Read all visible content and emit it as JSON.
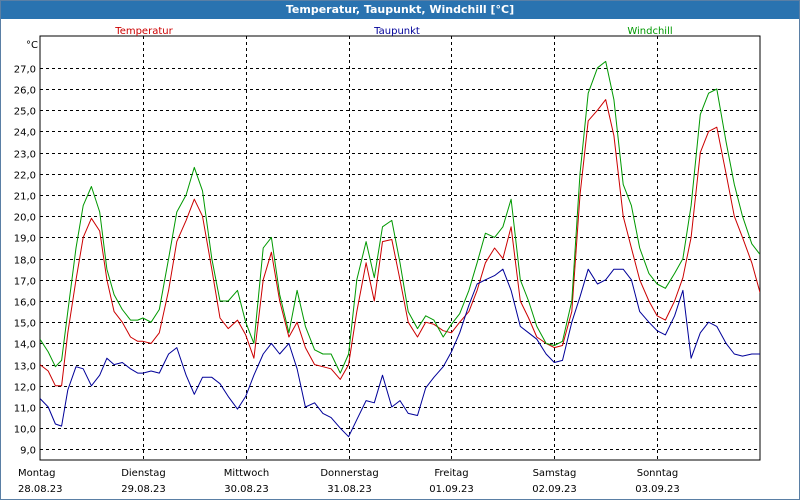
{
  "window": {
    "title": "Temperatur, Taupunkt, Windchill [°C]"
  },
  "chart_data": {
    "type": "line",
    "title": "Temperatur, Taupunkt, Windchill [°C]",
    "ylabel": "°C",
    "ylim": [
      8.5,
      28.5
    ],
    "yticks": [
      "9,0",
      "10,0",
      "11,0",
      "12,0",
      "13,0",
      "14,0",
      "15,0",
      "16,0",
      "17,0",
      "18,0",
      "19,0",
      "20,0",
      "21,0",
      "22,0",
      "23,0",
      "24,0",
      "25,0",
      "26,0",
      "27,0"
    ],
    "xlim": [
      0,
      7
    ],
    "x_unit": "days since 28.08.23 00:00",
    "days": [
      {
        "weekday": "Montag",
        "date": "28.08.23"
      },
      {
        "weekday": "Dienstag",
        "date": "29.08.23"
      },
      {
        "weekday": "Mittwoch",
        "date": "30.08.23"
      },
      {
        "weekday": "Donnerstag",
        "date": "31.08.23"
      },
      {
        "weekday": "Freitag",
        "date": "01.09.23"
      },
      {
        "weekday": "Samstag",
        "date": "02.09.23"
      },
      {
        "weekday": "Sonntag",
        "date": "03.09.23"
      }
    ],
    "grid": true,
    "legend_position": "top",
    "series": [
      {
        "name": "Temperatur",
        "color": "#cc0000",
        "x": [
          0.0,
          0.08,
          0.15,
          0.21,
          0.27,
          0.35,
          0.42,
          0.5,
          0.58,
          0.65,
          0.72,
          0.8,
          0.88,
          0.95,
          1.0,
          1.08,
          1.16,
          1.25,
          1.33,
          1.42,
          1.5,
          1.58,
          1.67,
          1.75,
          1.83,
          1.92,
          2.0,
          2.08,
          2.17,
          2.25,
          2.33,
          2.42,
          2.5,
          2.58,
          2.67,
          2.75,
          2.83,
          2.92,
          3.0,
          3.08,
          3.17,
          3.25,
          3.33,
          3.42,
          3.5,
          3.58,
          3.67,
          3.75,
          3.83,
          3.92,
          4.0,
          4.08,
          4.17,
          4.25,
          4.33,
          4.42,
          4.5,
          4.58,
          4.67,
          4.75,
          4.83,
          4.92,
          5.0,
          5.08,
          5.17,
          5.25,
          5.33,
          5.42,
          5.5,
          5.58,
          5.67,
          5.75,
          5.83,
          5.92,
          6.0,
          6.08,
          6.17,
          6.25,
          6.33,
          6.42,
          6.5,
          6.58,
          6.67,
          6.75,
          6.83,
          6.92,
          7.0
        ],
        "values": [
          13.0,
          12.7,
          12.0,
          12.0,
          14.5,
          17.0,
          19.0,
          19.9,
          19.3,
          17.0,
          15.5,
          15.0,
          14.3,
          14.1,
          14.1,
          14.0,
          14.5,
          16.5,
          18.8,
          19.8,
          20.8,
          20.0,
          17.5,
          15.2,
          14.7,
          15.1,
          14.4,
          13.3,
          17.0,
          18.3,
          16.0,
          14.3,
          15.0,
          13.8,
          13.0,
          12.9,
          12.8,
          12.3,
          13.0,
          15.5,
          17.8,
          16.0,
          18.8,
          18.9,
          17.0,
          15.0,
          14.3,
          15.0,
          14.9,
          14.6,
          14.5,
          15.0,
          15.5,
          16.5,
          17.8,
          18.5,
          18.0,
          19.5,
          16.0,
          15.2,
          14.3,
          14.0,
          13.8,
          13.9,
          15.5,
          21.0,
          24.5,
          25.0,
          25.5,
          23.8,
          20.0,
          18.5,
          17.0,
          16.0,
          15.3,
          15.1,
          16.0,
          17.1,
          19.0,
          23.0,
          24.0,
          24.2,
          22.0,
          20.0,
          19.0,
          17.8,
          16.4
        ]
      },
      {
        "name": "Taupunkt",
        "color": "#000099",
        "x": [
          0.0,
          0.08,
          0.15,
          0.21,
          0.27,
          0.35,
          0.42,
          0.5,
          0.58,
          0.65,
          0.72,
          0.8,
          0.88,
          0.95,
          1.0,
          1.08,
          1.16,
          1.25,
          1.33,
          1.42,
          1.5,
          1.58,
          1.67,
          1.75,
          1.83,
          1.92,
          2.0,
          2.08,
          2.17,
          2.25,
          2.33,
          2.42,
          2.5,
          2.58,
          2.67,
          2.75,
          2.83,
          2.92,
          3.0,
          3.08,
          3.17,
          3.25,
          3.33,
          3.42,
          3.5,
          3.58,
          3.67,
          3.75,
          3.83,
          3.92,
          4.0,
          4.08,
          4.17,
          4.25,
          4.33,
          4.42,
          4.5,
          4.58,
          4.67,
          4.75,
          4.83,
          4.92,
          5.0,
          5.08,
          5.17,
          5.25,
          5.33,
          5.42,
          5.5,
          5.58,
          5.67,
          5.75,
          5.83,
          5.92,
          6.0,
          6.08,
          6.17,
          6.25,
          6.33,
          6.42,
          6.5,
          6.58,
          6.67,
          6.75,
          6.83,
          6.92,
          7.0
        ],
        "values": [
          11.4,
          11.0,
          10.2,
          10.1,
          11.8,
          12.9,
          12.8,
          12.0,
          12.5,
          13.3,
          13.0,
          13.1,
          12.8,
          12.6,
          12.6,
          12.7,
          12.6,
          13.5,
          13.8,
          12.5,
          11.6,
          12.4,
          12.4,
          12.1,
          11.5,
          10.9,
          11.5,
          12.5,
          13.5,
          14.0,
          13.5,
          14.0,
          12.8,
          11.0,
          11.2,
          10.7,
          10.5,
          10.0,
          9.6,
          10.4,
          11.3,
          11.2,
          12.5,
          11.0,
          11.3,
          10.7,
          10.6,
          11.9,
          12.4,
          12.9,
          13.6,
          14.5,
          15.8,
          16.8,
          17.0,
          17.2,
          17.5,
          16.5,
          14.8,
          14.5,
          14.2,
          13.5,
          13.1,
          13.2,
          15.0,
          16.2,
          17.5,
          16.8,
          17.0,
          17.5,
          17.5,
          17.0,
          15.5,
          15.0,
          14.6,
          14.4,
          15.3,
          16.5,
          13.3,
          14.5,
          15.0,
          14.8,
          14.0,
          13.5,
          13.4,
          13.5,
          13.5
        ]
      },
      {
        "name": "Windchill",
        "color": "#009900",
        "x": [
          0.0,
          0.08,
          0.15,
          0.21,
          0.27,
          0.35,
          0.42,
          0.5,
          0.58,
          0.65,
          0.72,
          0.8,
          0.88,
          0.95,
          1.0,
          1.08,
          1.16,
          1.25,
          1.33,
          1.42,
          1.5,
          1.58,
          1.67,
          1.75,
          1.83,
          1.92,
          2.0,
          2.08,
          2.17,
          2.25,
          2.33,
          2.42,
          2.5,
          2.58,
          2.67,
          2.75,
          2.83,
          2.92,
          3.0,
          3.08,
          3.17,
          3.25,
          3.33,
          3.42,
          3.5,
          3.58,
          3.67,
          3.75,
          3.83,
          3.92,
          4.0,
          4.08,
          4.17,
          4.25,
          4.33,
          4.42,
          4.5,
          4.58,
          4.67,
          4.75,
          4.83,
          4.92,
          5.0,
          5.08,
          5.17,
          5.25,
          5.33,
          5.42,
          5.5,
          5.58,
          5.67,
          5.75,
          5.83,
          5.92,
          6.0,
          6.08,
          6.17,
          6.25,
          6.33,
          6.42,
          6.5,
          6.58,
          6.67,
          6.75,
          6.83,
          6.92,
          7.0
        ],
        "values": [
          14.2,
          13.6,
          12.9,
          13.2,
          15.5,
          18.5,
          20.5,
          21.4,
          20.2,
          17.5,
          16.3,
          15.6,
          15.1,
          15.1,
          15.2,
          15.0,
          15.6,
          18.0,
          20.2,
          21.0,
          22.3,
          21.2,
          18.0,
          16.0,
          16.0,
          16.5,
          15.0,
          14.0,
          18.5,
          19.0,
          16.3,
          14.5,
          16.5,
          14.8,
          13.7,
          13.5,
          13.5,
          12.6,
          13.5,
          17.0,
          18.8,
          17.1,
          19.5,
          19.8,
          17.8,
          15.5,
          14.7,
          15.3,
          15.1,
          14.3,
          14.9,
          15.4,
          16.5,
          17.8,
          19.2,
          19.0,
          19.5,
          20.8,
          17.0,
          16.0,
          14.8,
          14.0,
          13.9,
          14.1,
          16.0,
          22.0,
          25.8,
          27.0,
          27.3,
          25.5,
          21.5,
          20.5,
          18.5,
          17.3,
          16.8,
          16.6,
          17.3,
          18.0,
          20.5,
          24.8,
          25.8,
          26.0,
          23.5,
          21.5,
          20.0,
          18.7,
          18.2
        ]
      }
    ]
  }
}
